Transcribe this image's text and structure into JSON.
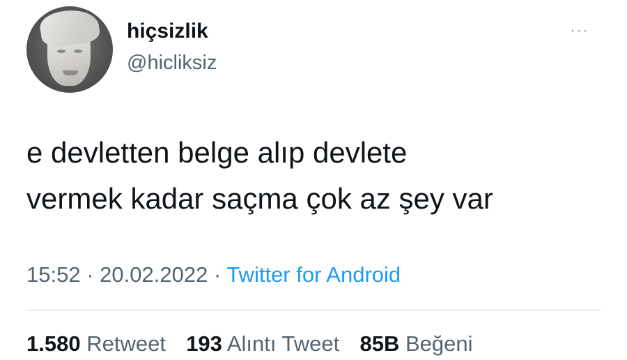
{
  "user": {
    "display_name": "hiçsizlik",
    "handle": "@hicliksiz",
    "avatar_icon": "masked-face-avatar"
  },
  "menu": {
    "more_icon": "···"
  },
  "tweet": {
    "line1": "e devletten belge alıp devlete",
    "line2": "vermek kadar saçma çok az şey var"
  },
  "meta": {
    "time": "15:52",
    "separator": "·",
    "date": "20.02.2022",
    "source": "Twitter for Android"
  },
  "stats": {
    "retweets_count": "1.580",
    "retweets_label": "Retweet",
    "quotes_count": "193",
    "quotes_label": "Alıntı Tweet",
    "likes_count": "85B",
    "likes_label": "Beğeni"
  },
  "colors": {
    "link": "#1d9bf0",
    "secondary_text": "#536471",
    "primary_text": "#0f1419"
  }
}
